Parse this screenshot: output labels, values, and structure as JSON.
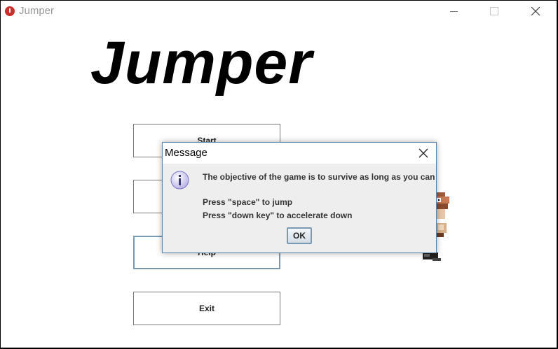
{
  "window": {
    "title": "Jumper"
  },
  "game": {
    "title": "Jumper"
  },
  "menu": {
    "start_label": "Start",
    "options_label": "",
    "help_label": "Help",
    "exit_label": "Exit"
  },
  "dialog": {
    "title": "Message",
    "line1": "The objective of the game is to survive as long as you can",
    "line2": "Press \"space\" to jump",
    "line3": "Press \"down key\" to accelerate down",
    "ok_label": "OK",
    "icon": "info-icon"
  },
  "colors": {
    "app_icon": "#c8302c",
    "dialog_border": "#5d86ad",
    "focus_border": "#7a9ab4"
  }
}
